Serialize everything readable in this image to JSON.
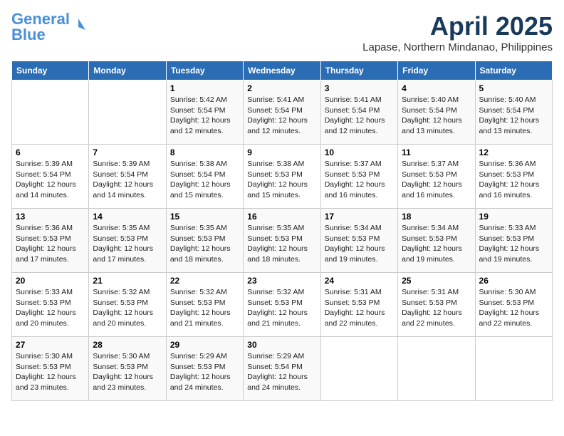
{
  "logo": {
    "line1": "General",
    "line2": "Blue"
  },
  "title": "April 2025",
  "location": "Lapase, Northern Mindanao, Philippines",
  "days_of_week": [
    "Sunday",
    "Monday",
    "Tuesday",
    "Wednesday",
    "Thursday",
    "Friday",
    "Saturday"
  ],
  "weeks": [
    [
      {
        "day": "",
        "info": ""
      },
      {
        "day": "",
        "info": ""
      },
      {
        "day": "1",
        "info": "Sunrise: 5:42 AM\nSunset: 5:54 PM\nDaylight: 12 hours\nand 12 minutes."
      },
      {
        "day": "2",
        "info": "Sunrise: 5:41 AM\nSunset: 5:54 PM\nDaylight: 12 hours\nand 12 minutes."
      },
      {
        "day": "3",
        "info": "Sunrise: 5:41 AM\nSunset: 5:54 PM\nDaylight: 12 hours\nand 12 minutes."
      },
      {
        "day": "4",
        "info": "Sunrise: 5:40 AM\nSunset: 5:54 PM\nDaylight: 12 hours\nand 13 minutes."
      },
      {
        "day": "5",
        "info": "Sunrise: 5:40 AM\nSunset: 5:54 PM\nDaylight: 12 hours\nand 13 minutes."
      }
    ],
    [
      {
        "day": "6",
        "info": "Sunrise: 5:39 AM\nSunset: 5:54 PM\nDaylight: 12 hours\nand 14 minutes."
      },
      {
        "day": "7",
        "info": "Sunrise: 5:39 AM\nSunset: 5:54 PM\nDaylight: 12 hours\nand 14 minutes."
      },
      {
        "day": "8",
        "info": "Sunrise: 5:38 AM\nSunset: 5:54 PM\nDaylight: 12 hours\nand 15 minutes."
      },
      {
        "day": "9",
        "info": "Sunrise: 5:38 AM\nSunset: 5:53 PM\nDaylight: 12 hours\nand 15 minutes."
      },
      {
        "day": "10",
        "info": "Sunrise: 5:37 AM\nSunset: 5:53 PM\nDaylight: 12 hours\nand 16 minutes."
      },
      {
        "day": "11",
        "info": "Sunrise: 5:37 AM\nSunset: 5:53 PM\nDaylight: 12 hours\nand 16 minutes."
      },
      {
        "day": "12",
        "info": "Sunrise: 5:36 AM\nSunset: 5:53 PM\nDaylight: 12 hours\nand 16 minutes."
      }
    ],
    [
      {
        "day": "13",
        "info": "Sunrise: 5:36 AM\nSunset: 5:53 PM\nDaylight: 12 hours\nand 17 minutes."
      },
      {
        "day": "14",
        "info": "Sunrise: 5:35 AM\nSunset: 5:53 PM\nDaylight: 12 hours\nand 17 minutes."
      },
      {
        "day": "15",
        "info": "Sunrise: 5:35 AM\nSunset: 5:53 PM\nDaylight: 12 hours\nand 18 minutes."
      },
      {
        "day": "16",
        "info": "Sunrise: 5:35 AM\nSunset: 5:53 PM\nDaylight: 12 hours\nand 18 minutes."
      },
      {
        "day": "17",
        "info": "Sunrise: 5:34 AM\nSunset: 5:53 PM\nDaylight: 12 hours\nand 19 minutes."
      },
      {
        "day": "18",
        "info": "Sunrise: 5:34 AM\nSunset: 5:53 PM\nDaylight: 12 hours\nand 19 minutes."
      },
      {
        "day": "19",
        "info": "Sunrise: 5:33 AM\nSunset: 5:53 PM\nDaylight: 12 hours\nand 19 minutes."
      }
    ],
    [
      {
        "day": "20",
        "info": "Sunrise: 5:33 AM\nSunset: 5:53 PM\nDaylight: 12 hours\nand 20 minutes."
      },
      {
        "day": "21",
        "info": "Sunrise: 5:32 AM\nSunset: 5:53 PM\nDaylight: 12 hours\nand 20 minutes."
      },
      {
        "day": "22",
        "info": "Sunrise: 5:32 AM\nSunset: 5:53 PM\nDaylight: 12 hours\nand 21 minutes."
      },
      {
        "day": "23",
        "info": "Sunrise: 5:32 AM\nSunset: 5:53 PM\nDaylight: 12 hours\nand 21 minutes."
      },
      {
        "day": "24",
        "info": "Sunrise: 5:31 AM\nSunset: 5:53 PM\nDaylight: 12 hours\nand 22 minutes."
      },
      {
        "day": "25",
        "info": "Sunrise: 5:31 AM\nSunset: 5:53 PM\nDaylight: 12 hours\nand 22 minutes."
      },
      {
        "day": "26",
        "info": "Sunrise: 5:30 AM\nSunset: 5:53 PM\nDaylight: 12 hours\nand 22 minutes."
      }
    ],
    [
      {
        "day": "27",
        "info": "Sunrise: 5:30 AM\nSunset: 5:53 PM\nDaylight: 12 hours\nand 23 minutes."
      },
      {
        "day": "28",
        "info": "Sunrise: 5:30 AM\nSunset: 5:53 PM\nDaylight: 12 hours\nand 23 minutes."
      },
      {
        "day": "29",
        "info": "Sunrise: 5:29 AM\nSunset: 5:53 PM\nDaylight: 12 hours\nand 24 minutes."
      },
      {
        "day": "30",
        "info": "Sunrise: 5:29 AM\nSunset: 5:54 PM\nDaylight: 12 hours\nand 24 minutes."
      },
      {
        "day": "",
        "info": ""
      },
      {
        "day": "",
        "info": ""
      },
      {
        "day": "",
        "info": ""
      }
    ]
  ]
}
